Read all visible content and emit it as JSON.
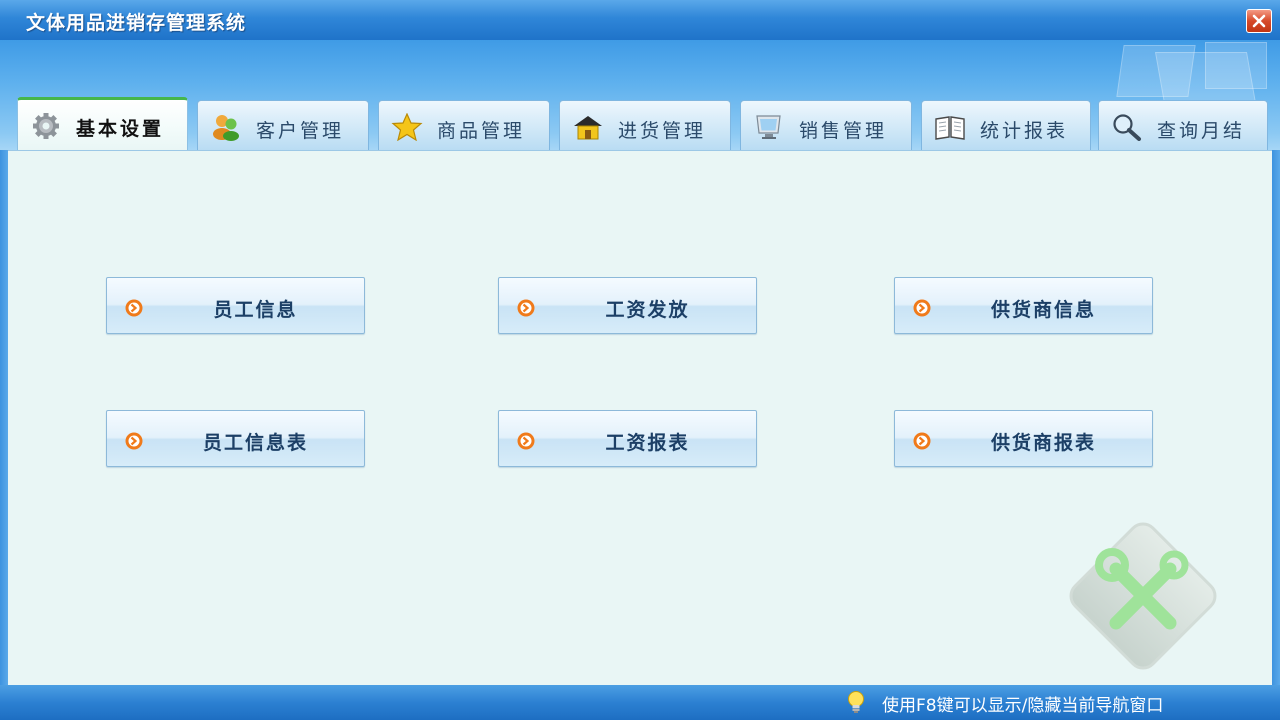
{
  "window": {
    "title": "文体用品进销存管理系统"
  },
  "tabs": [
    {
      "label": "基本设置",
      "icon": "gear-icon",
      "active": true
    },
    {
      "label": "客户管理",
      "icon": "users-icon",
      "active": false
    },
    {
      "label": "商品管理",
      "icon": "star-icon",
      "active": false
    },
    {
      "label": "进货管理",
      "icon": "house-icon",
      "active": false
    },
    {
      "label": "销售管理",
      "icon": "monitor-icon",
      "active": false
    },
    {
      "label": "统计报表",
      "icon": "book-icon",
      "active": false
    },
    {
      "label": "查询月结",
      "icon": "magnifier-icon",
      "active": false
    }
  ],
  "buttons": [
    {
      "label": "员工信息",
      "icon": "arrow-right-circle-icon"
    },
    {
      "label": "工资发放",
      "icon": "arrow-right-circle-icon"
    },
    {
      "label": "供货商信息",
      "icon": "arrow-right-circle-icon"
    },
    {
      "label": "员工信息表",
      "icon": "arrow-right-circle-icon"
    },
    {
      "label": "工资报表",
      "icon": "arrow-right-circle-icon"
    },
    {
      "label": "供货商报表",
      "icon": "arrow-right-circle-icon"
    }
  ],
  "statusbar": {
    "hint": "使用F8键可以显示/隐藏当前导航窗口",
    "icon": "lightbulb-icon"
  },
  "colors": {
    "titlebar": "#2f86d8",
    "content_bg": "#e9f6f5",
    "active_tab_accent": "#46b64b",
    "button_text": "#1c3f66",
    "arrow_icon": "#f07a1a"
  }
}
